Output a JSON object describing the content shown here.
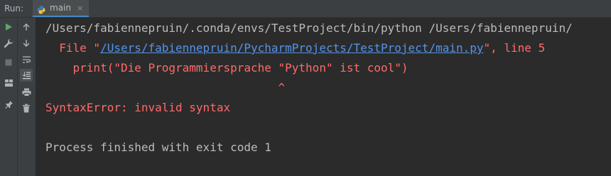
{
  "run_panel": {
    "label": "Run:",
    "tab": {
      "label": "main",
      "icon": "python-file-icon",
      "close": "×"
    }
  },
  "toolbar_left": [
    {
      "name": "rerun-icon",
      "color": "#59a869"
    },
    {
      "name": "wrench-icon",
      "color": "#afb1b3"
    },
    {
      "name": "stop-icon",
      "color": "#6e6e6e"
    },
    {
      "name": "layout-icon",
      "color": "#afb1b3"
    },
    {
      "name": "pin-icon",
      "color": "#afb1b3"
    }
  ],
  "toolbar_right": [
    {
      "name": "arrow-up-icon"
    },
    {
      "name": "arrow-down-icon"
    },
    {
      "name": "soft-wrap-icon"
    },
    {
      "name": "scroll-to-end-icon",
      "active": true
    },
    {
      "name": "print-icon"
    },
    {
      "name": "trash-icon"
    }
  ],
  "console": {
    "command": "/Users/fabiennepruin/.conda/envs/TestProject/bin/python /Users/fabiennepruin/",
    "file_prefix": "  File \"",
    "file_link": "/Users/fabiennepruin/PycharmProjects/TestProject/main.py",
    "file_suffix": "\", line 5",
    "code_line": "    print(\"Die Programmiersprache \"Python\" ist cool\")",
    "caret_line": "                                  ^",
    "error_line": "SyntaxError: invalid syntax",
    "exit_line": "Process finished with exit code 1"
  },
  "colors": {
    "background": "#2b2b2b",
    "toolbar": "#3c3f41",
    "normal_text": "#bbbbbb",
    "error_text": "#ff6b68",
    "link": "#5394ec",
    "tab_underline": "#4a88c7"
  }
}
